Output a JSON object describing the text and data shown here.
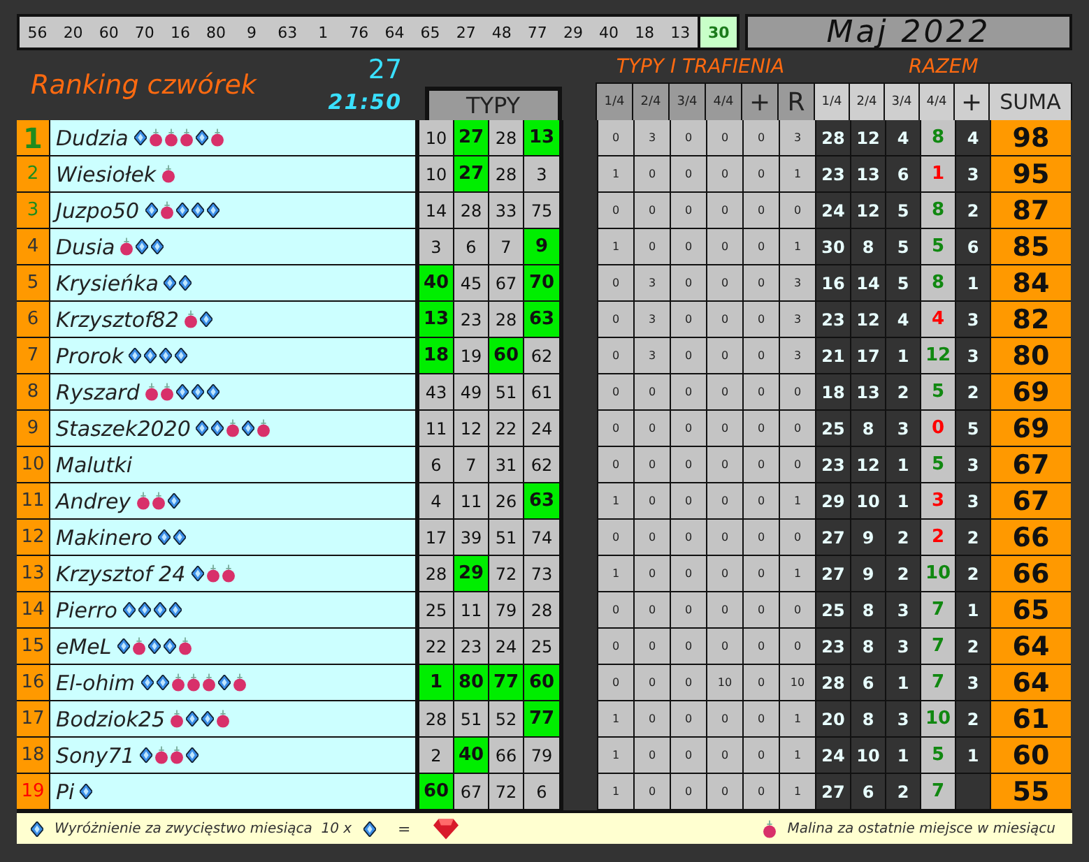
{
  "draw": {
    "numbers": [
      {
        "value": "56",
        "current": false
      },
      {
        "value": "20",
        "current": false
      },
      {
        "value": "60",
        "current": false
      },
      {
        "value": "70",
        "current": false
      },
      {
        "value": "16",
        "current": false
      },
      {
        "value": "80",
        "current": false
      },
      {
        "value": "9",
        "current": false
      },
      {
        "value": "63",
        "current": false
      },
      {
        "value": "1",
        "current": false
      },
      {
        "value": "76",
        "current": false
      },
      {
        "value": "64",
        "current": false
      },
      {
        "value": "65",
        "current": false
      },
      {
        "value": "27",
        "current": false
      },
      {
        "value": "48",
        "current": false
      },
      {
        "value": "77",
        "current": false
      },
      {
        "value": "29",
        "current": false
      },
      {
        "value": "40",
        "current": false
      },
      {
        "value": "18",
        "current": false
      },
      {
        "value": "13",
        "current": false
      },
      {
        "value": "30",
        "current": true
      }
    ],
    "month": "Maj 2022"
  },
  "header": {
    "title": "Ranking czwórek",
    "count": "27",
    "time": "21:50",
    "typy_label": "TYPY",
    "tt_title": "TYPY I TRAFIENIA",
    "razem_title": "RAZEM",
    "tt_columns": [
      "1/4",
      "2/4",
      "3/4",
      "4/4",
      "+",
      "R"
    ],
    "razem_columns": [
      "1/4",
      "2/4",
      "3/4",
      "4/4",
      "+"
    ],
    "suma_column": "SUMA"
  },
  "rows": [
    {
      "rank": "1",
      "color": "#1e8c1e",
      "name": "Dudzia",
      "awards": [
        {
          "kind": "diamond"
        },
        {
          "kind": "berry"
        },
        {
          "kind": "berry"
        },
        {
          "kind": "berry"
        },
        {
          "kind": "diamond"
        },
        {
          "kind": "berry"
        }
      ],
      "picks": [
        {
          "value": "10",
          "hit": false
        },
        {
          "value": "27",
          "hit": true
        },
        {
          "value": "28",
          "hit": false
        },
        {
          "value": "13",
          "hit": true
        }
      ],
      "tt": [
        "0",
        "3",
        "0",
        "0",
        "0",
        "3"
      ],
      "razem": [
        "28",
        "12",
        "4"
      ],
      "four": {
        "value": "8",
        "good": true
      },
      "plus": "4",
      "suma": "98"
    },
    {
      "rank": "2",
      "color": "#1e8c1e",
      "name": "Wiesiołek",
      "awards": [
        {
          "kind": "berry"
        }
      ],
      "picks": [
        {
          "value": "10",
          "hit": false
        },
        {
          "value": "27",
          "hit": true
        },
        {
          "value": "28",
          "hit": false
        },
        {
          "value": "3",
          "hit": false
        }
      ],
      "tt": [
        "1",
        "0",
        "0",
        "0",
        "0",
        "1"
      ],
      "razem": [
        "23",
        "13",
        "6"
      ],
      "four": {
        "value": "1",
        "good": false
      },
      "plus": "3",
      "suma": "95"
    },
    {
      "rank": "3",
      "color": "#1e8c1e",
      "name": "Juzpo50",
      "awards": [
        {
          "kind": "diamond"
        },
        {
          "kind": "berry"
        },
        {
          "kind": "diamond"
        },
        {
          "kind": "diamond"
        },
        {
          "kind": "diamond"
        }
      ],
      "picks": [
        {
          "value": "14",
          "hit": false
        },
        {
          "value": "28",
          "hit": false
        },
        {
          "value": "33",
          "hit": false
        },
        {
          "value": "75",
          "hit": false
        }
      ],
      "tt": [
        "0",
        "0",
        "0",
        "0",
        "0",
        "0"
      ],
      "razem": [
        "24",
        "12",
        "5"
      ],
      "four": {
        "value": "8",
        "good": true
      },
      "plus": "2",
      "suma": "87"
    },
    {
      "rank": "4",
      "color": "#333333",
      "name": "Dusia",
      "awards": [
        {
          "kind": "berry"
        },
        {
          "kind": "diamond"
        },
        {
          "kind": "diamond"
        }
      ],
      "picks": [
        {
          "value": "3",
          "hit": false
        },
        {
          "value": "6",
          "hit": false
        },
        {
          "value": "7",
          "hit": false
        },
        {
          "value": "9",
          "hit": true
        }
      ],
      "tt": [
        "1",
        "0",
        "0",
        "0",
        "0",
        "1"
      ],
      "razem": [
        "30",
        "8",
        "5"
      ],
      "four": {
        "value": "5",
        "good": true
      },
      "plus": "6",
      "suma": "85"
    },
    {
      "rank": "5",
      "color": "#333333",
      "name": "Krysieńka",
      "awards": [
        {
          "kind": "diamond"
        },
        {
          "kind": "diamond"
        }
      ],
      "picks": [
        {
          "value": "40",
          "hit": true
        },
        {
          "value": "45",
          "hit": false
        },
        {
          "value": "67",
          "hit": false
        },
        {
          "value": "70",
          "hit": true
        }
      ],
      "tt": [
        "0",
        "3",
        "0",
        "0",
        "0",
        "3"
      ],
      "razem": [
        "16",
        "14",
        "5"
      ],
      "four": {
        "value": "8",
        "good": true
      },
      "plus": "1",
      "suma": "84"
    },
    {
      "rank": "6",
      "color": "#333333",
      "name": "Krzysztof82",
      "awards": [
        {
          "kind": "berry"
        },
        {
          "kind": "diamond"
        }
      ],
      "picks": [
        {
          "value": "13",
          "hit": true
        },
        {
          "value": "23",
          "hit": false
        },
        {
          "value": "28",
          "hit": false
        },
        {
          "value": "63",
          "hit": true
        }
      ],
      "tt": [
        "0",
        "3",
        "0",
        "0",
        "0",
        "3"
      ],
      "razem": [
        "23",
        "12",
        "4"
      ],
      "four": {
        "value": "4",
        "good": false
      },
      "plus": "3",
      "suma": "82"
    },
    {
      "rank": "7",
      "color": "#333333",
      "name": "Prorok",
      "awards": [
        {
          "kind": "diamond"
        },
        {
          "kind": "diamond"
        },
        {
          "kind": "diamond"
        },
        {
          "kind": "diamond"
        }
      ],
      "picks": [
        {
          "value": "18",
          "hit": true
        },
        {
          "value": "19",
          "hit": false
        },
        {
          "value": "60",
          "hit": true
        },
        {
          "value": "62",
          "hit": false
        }
      ],
      "tt": [
        "0",
        "3",
        "0",
        "0",
        "0",
        "3"
      ],
      "razem": [
        "21",
        "17",
        "1"
      ],
      "four": {
        "value": "12",
        "good": true
      },
      "plus": "3",
      "suma": "80"
    },
    {
      "rank": "8",
      "color": "#333333",
      "name": "Ryszard",
      "awards": [
        {
          "kind": "berry"
        },
        {
          "kind": "berry"
        },
        {
          "kind": "diamond"
        },
        {
          "kind": "diamond"
        },
        {
          "kind": "diamond"
        }
      ],
      "picks": [
        {
          "value": "43",
          "hit": false
        },
        {
          "value": "49",
          "hit": false
        },
        {
          "value": "51",
          "hit": false
        },
        {
          "value": "61",
          "hit": false
        }
      ],
      "tt": [
        "0",
        "0",
        "0",
        "0",
        "0",
        "0"
      ],
      "razem": [
        "18",
        "13",
        "2"
      ],
      "four": {
        "value": "5",
        "good": true
      },
      "plus": "2",
      "suma": "69"
    },
    {
      "rank": "9",
      "color": "#333333",
      "name": "Staszek2020",
      "awards": [
        {
          "kind": "diamond"
        },
        {
          "kind": "diamond"
        },
        {
          "kind": "berry"
        },
        {
          "kind": "diamond"
        },
        {
          "kind": "berry"
        }
      ],
      "picks": [
        {
          "value": "11",
          "hit": false
        },
        {
          "value": "12",
          "hit": false
        },
        {
          "value": "22",
          "hit": false
        },
        {
          "value": "24",
          "hit": false
        }
      ],
      "tt": [
        "0",
        "0",
        "0",
        "0",
        "0",
        "0"
      ],
      "razem": [
        "25",
        "8",
        "3"
      ],
      "four": {
        "value": "0",
        "good": false
      },
      "plus": "5",
      "suma": "69"
    },
    {
      "rank": "10",
      "color": "#333333",
      "name": "Malutki",
      "awards": [],
      "picks": [
        {
          "value": "6",
          "hit": false
        },
        {
          "value": "7",
          "hit": false
        },
        {
          "value": "31",
          "hit": false
        },
        {
          "value": "62",
          "hit": false
        }
      ],
      "tt": [
        "0",
        "0",
        "0",
        "0",
        "0",
        "0"
      ],
      "razem": [
        "23",
        "12",
        "1"
      ],
      "four": {
        "value": "5",
        "good": true
      },
      "plus": "3",
      "suma": "67"
    },
    {
      "rank": "11",
      "color": "#333333",
      "name": "Andrey",
      "awards": [
        {
          "kind": "berry"
        },
        {
          "kind": "berry"
        },
        {
          "kind": "diamond"
        }
      ],
      "picks": [
        {
          "value": "4",
          "hit": false
        },
        {
          "value": "11",
          "hit": false
        },
        {
          "value": "26",
          "hit": false
        },
        {
          "value": "63",
          "hit": true
        }
      ],
      "tt": [
        "1",
        "0",
        "0",
        "0",
        "0",
        "1"
      ],
      "razem": [
        "29",
        "10",
        "1"
      ],
      "four": {
        "value": "3",
        "good": false
      },
      "plus": "3",
      "suma": "67"
    },
    {
      "rank": "12",
      "color": "#333333",
      "name": "Makinero",
      "awards": [
        {
          "kind": "diamond"
        },
        {
          "kind": "diamond"
        }
      ],
      "picks": [
        {
          "value": "17",
          "hit": false
        },
        {
          "value": "39",
          "hit": false
        },
        {
          "value": "51",
          "hit": false
        },
        {
          "value": "74",
          "hit": false
        }
      ],
      "tt": [
        "0",
        "0",
        "0",
        "0",
        "0",
        "0"
      ],
      "razem": [
        "27",
        "9",
        "2"
      ],
      "four": {
        "value": "2",
        "good": false
      },
      "plus": "2",
      "suma": "66"
    },
    {
      "rank": "13",
      "color": "#333333",
      "name": "Krzysztof 24",
      "awards": [
        {
          "kind": "diamond"
        },
        {
          "kind": "berry"
        },
        {
          "kind": "berry"
        }
      ],
      "picks": [
        {
          "value": "28",
          "hit": false
        },
        {
          "value": "29",
          "hit": true
        },
        {
          "value": "72",
          "hit": false
        },
        {
          "value": "73",
          "hit": false
        }
      ],
      "tt": [
        "1",
        "0",
        "0",
        "0",
        "0",
        "1"
      ],
      "razem": [
        "27",
        "9",
        "2"
      ],
      "four": {
        "value": "10",
        "good": true
      },
      "plus": "2",
      "suma": "66"
    },
    {
      "rank": "14",
      "color": "#333333",
      "name": "Pierro",
      "awards": [
        {
          "kind": "diamond"
        },
        {
          "kind": "diamond"
        },
        {
          "kind": "diamond"
        },
        {
          "kind": "diamond"
        }
      ],
      "picks": [
        {
          "value": "25",
          "hit": false
        },
        {
          "value": "11",
          "hit": false
        },
        {
          "value": "79",
          "hit": false
        },
        {
          "value": "28",
          "hit": false
        }
      ],
      "tt": [
        "0",
        "0",
        "0",
        "0",
        "0",
        "0"
      ],
      "razem": [
        "25",
        "8",
        "3"
      ],
      "four": {
        "value": "7",
        "good": true
      },
      "plus": "1",
      "suma": "65"
    },
    {
      "rank": "15",
      "color": "#333333",
      "name": "eMeL",
      "awards": [
        {
          "kind": "diamond"
        },
        {
          "kind": "berry"
        },
        {
          "kind": "diamond"
        },
        {
          "kind": "diamond"
        },
        {
          "kind": "berry"
        }
      ],
      "picks": [
        {
          "value": "22",
          "hit": false
        },
        {
          "value": "23",
          "hit": false
        },
        {
          "value": "24",
          "hit": false
        },
        {
          "value": "25",
          "hit": false
        }
      ],
      "tt": [
        "0",
        "0",
        "0",
        "0",
        "0",
        "0"
      ],
      "razem": [
        "23",
        "8",
        "3"
      ],
      "four": {
        "value": "7",
        "good": true
      },
      "plus": "2",
      "suma": "64"
    },
    {
      "rank": "16",
      "color": "#333333",
      "name": "El-ohim",
      "awards": [
        {
          "kind": "diamond"
        },
        {
          "kind": "diamond"
        },
        {
          "kind": "berry"
        },
        {
          "kind": "berry"
        },
        {
          "kind": "berry"
        },
        {
          "kind": "diamond"
        },
        {
          "kind": "berry"
        }
      ],
      "picks": [
        {
          "value": "1",
          "hit": true
        },
        {
          "value": "80",
          "hit": true
        },
        {
          "value": "77",
          "hit": true
        },
        {
          "value": "60",
          "hit": true
        }
      ],
      "tt": [
        "0",
        "0",
        "0",
        "10",
        "0",
        "10"
      ],
      "razem": [
        "28",
        "6",
        "1"
      ],
      "four": {
        "value": "7",
        "good": true
      },
      "plus": "3",
      "suma": "64"
    },
    {
      "rank": "17",
      "color": "#333333",
      "name": "Bodziok25",
      "awards": [
        {
          "kind": "berry"
        },
        {
          "kind": "diamond"
        },
        {
          "kind": "diamond"
        },
        {
          "kind": "berry"
        }
      ],
      "picks": [
        {
          "value": "28",
          "hit": false
        },
        {
          "value": "51",
          "hit": false
        },
        {
          "value": "52",
          "hit": false
        },
        {
          "value": "77",
          "hit": true
        }
      ],
      "tt": [
        "1",
        "0",
        "0",
        "0",
        "0",
        "1"
      ],
      "razem": [
        "20",
        "8",
        "3"
      ],
      "four": {
        "value": "10",
        "good": true
      },
      "plus": "2",
      "suma": "61"
    },
    {
      "rank": "18",
      "color": "#333333",
      "name": "Sony71",
      "awards": [
        {
          "kind": "diamond"
        },
        {
          "kind": "berry"
        },
        {
          "kind": "berry"
        },
        {
          "kind": "diamond"
        }
      ],
      "picks": [
        {
          "value": "2",
          "hit": false
        },
        {
          "value": "40",
          "hit": true
        },
        {
          "value": "66",
          "hit": false
        },
        {
          "value": "79",
          "hit": false
        }
      ],
      "tt": [
        "1",
        "0",
        "0",
        "0",
        "0",
        "1"
      ],
      "razem": [
        "24",
        "10",
        "1"
      ],
      "four": {
        "value": "5",
        "good": true
      },
      "plus": "1",
      "suma": "60"
    },
    {
      "rank": "19",
      "color": "#ff0000",
      "name": "Pi",
      "awards": [
        {
          "kind": "diamond"
        }
      ],
      "picks": [
        {
          "value": "60",
          "hit": true
        },
        {
          "value": "67",
          "hit": false
        },
        {
          "value": "72",
          "hit": false
        },
        {
          "value": "6",
          "hit": false
        }
      ],
      "tt": [
        "1",
        "0",
        "0",
        "0",
        "0",
        "1"
      ],
      "razem": [
        "27",
        "6",
        "2"
      ],
      "four": {
        "value": "7",
        "good": true
      },
      "suma": "55"
    }
  ],
  "footer": {
    "award_text": "Wyróżnienie za zwycięstwo miesiąca  10 x",
    "equals": "=",
    "berry_text": "Malina za ostatnie miejsce w miesiącu"
  }
}
